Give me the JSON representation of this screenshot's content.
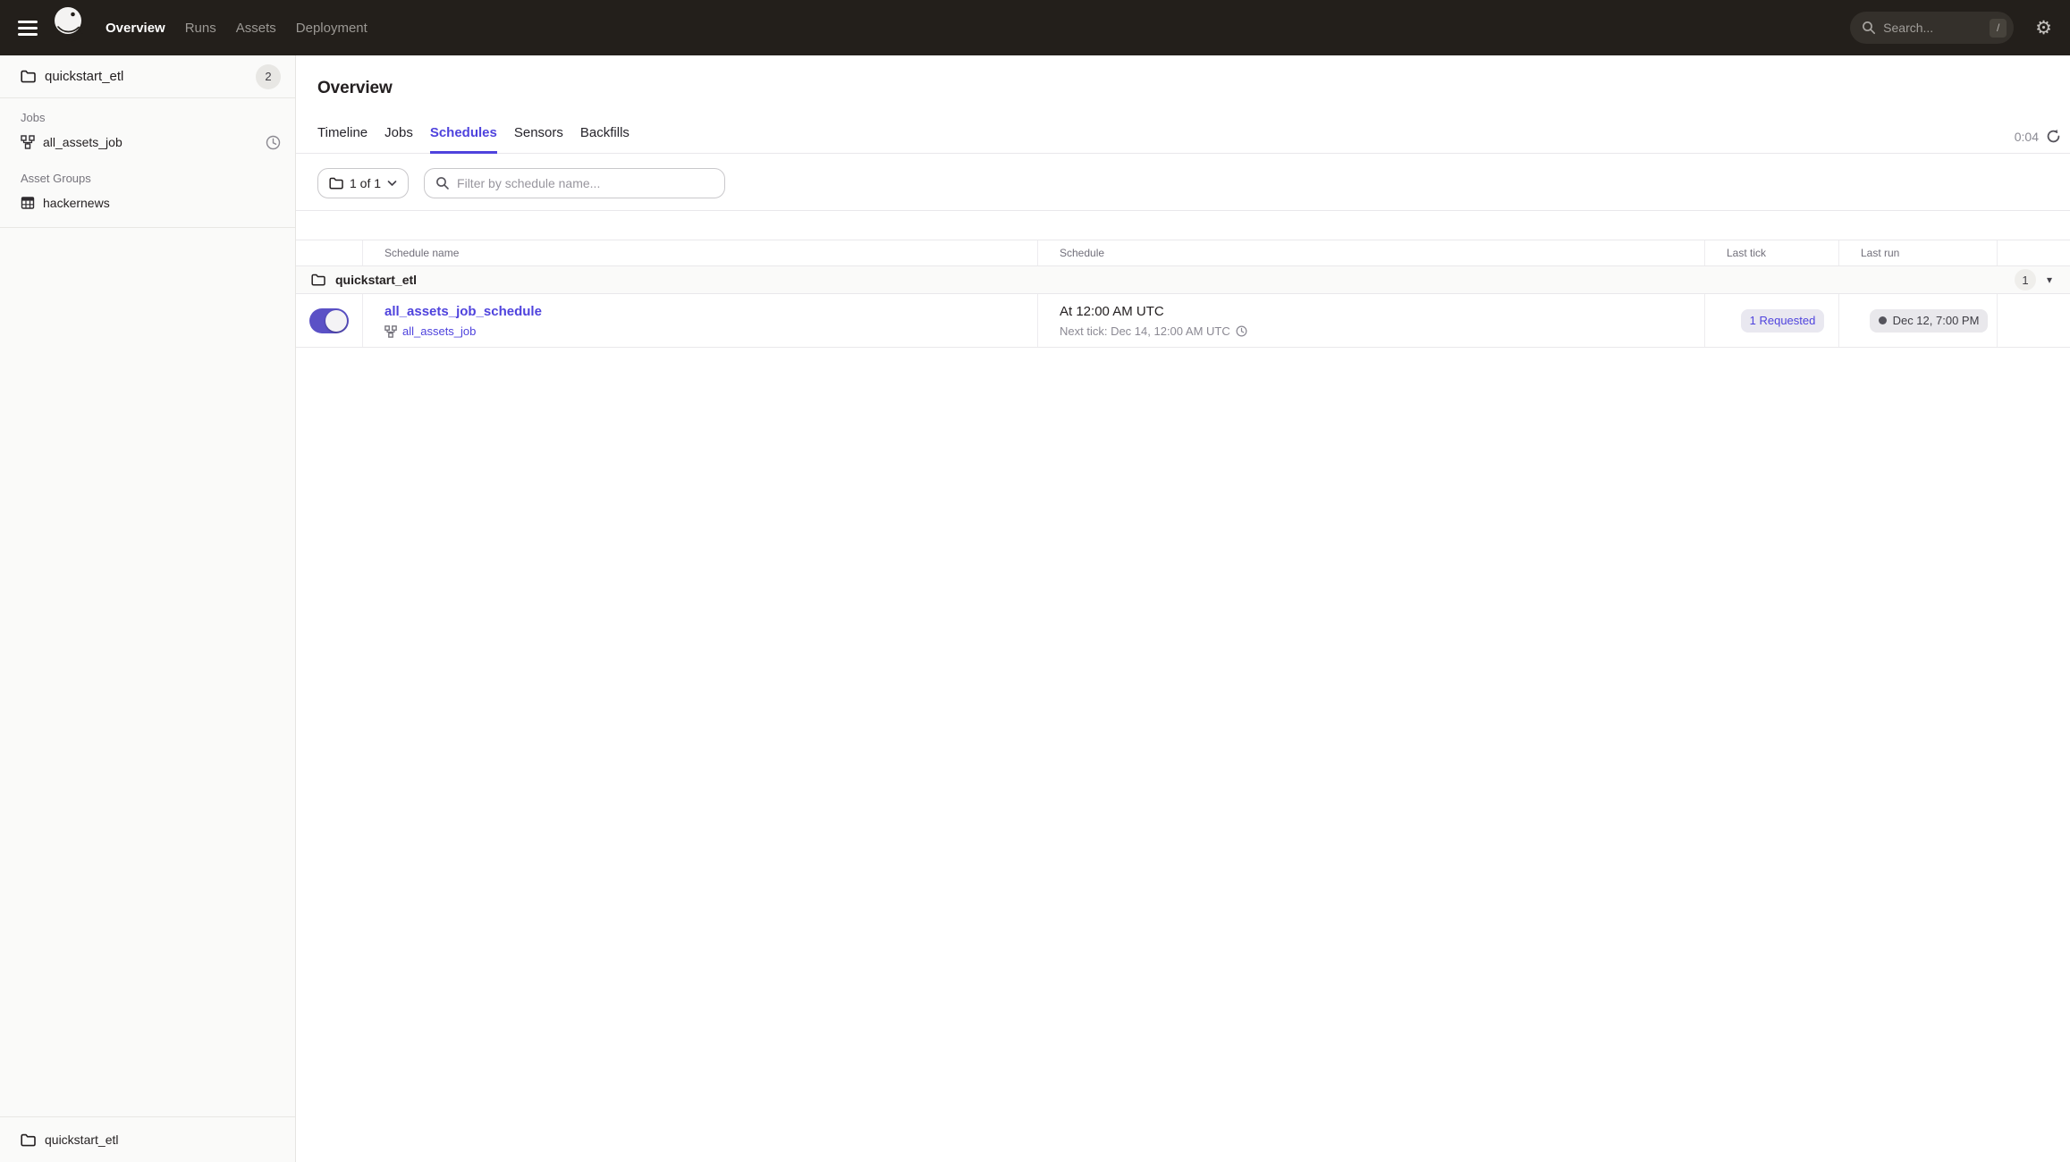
{
  "topnav": {
    "nav_items": [
      {
        "label": "Overview",
        "active": true
      },
      {
        "label": "Runs",
        "active": false
      },
      {
        "label": "Assets",
        "active": false
      },
      {
        "label": "Deployment",
        "active": false
      }
    ],
    "search_placeholder": "Search...",
    "search_shortcut": "/"
  },
  "sidebar": {
    "workspace_label": "quickstart_etl",
    "workspace_count": "2",
    "jobs_section_title": "Jobs",
    "job_item_label": "all_assets_job",
    "asset_groups_section_title": "Asset Groups",
    "asset_group_item_label": "hackernews",
    "footer_label": "quickstart_etl"
  },
  "main": {
    "page_title": "Overview",
    "tabs": [
      {
        "label": "Timeline",
        "active": false
      },
      {
        "label": "Jobs",
        "active": false
      },
      {
        "label": "Schedules",
        "active": true
      },
      {
        "label": "Sensors",
        "active": false
      },
      {
        "label": "Backfills",
        "active": false
      }
    ],
    "refresh_timer": "0:04",
    "repo_filter_label": "1 of 1",
    "filter_placeholder": "Filter by schedule name...",
    "table": {
      "columns": {
        "schedule_name": "Schedule name",
        "schedule": "Schedule",
        "last_tick": "Last tick",
        "last_run": "Last run"
      },
      "group_label": "quickstart_etl",
      "group_count": "1",
      "row": {
        "enabled": true,
        "schedule_name": "all_assets_job_schedule",
        "job_name": "all_assets_job",
        "schedule_time": "At 12:00 AM UTC",
        "next_tick": "Next tick: Dec 14, 12:00 AM UTC",
        "last_tick_status": "1 Requested",
        "last_run_time": "Dec 12, 7:00 PM"
      }
    }
  },
  "colors": {
    "accent": "#4F43DD",
    "topnav_bg": "#231F1B",
    "sidebar_bg": "#FAFAF9"
  }
}
